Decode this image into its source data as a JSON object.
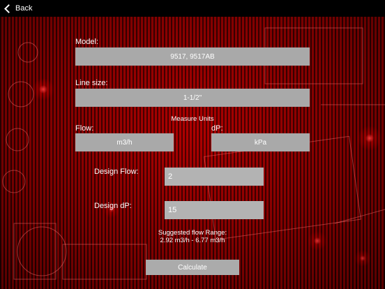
{
  "nav": {
    "back_label": "Back"
  },
  "form": {
    "model_label": "Model:",
    "model_value": "9517, 9517AB",
    "line_size_label": "Line size:",
    "line_size_value": "1-1/2\"",
    "measure_units_label": "Measure Units",
    "flow_label": "Flow:",
    "flow_unit": "m3/h",
    "dp_label": "dP:",
    "dp_unit": "kPa",
    "design_flow_label": "Design Flow:",
    "design_flow_value": "2",
    "design_dp_label": "Design dP:",
    "design_dp_value": "15",
    "suggested_title": "Suggested flow Range:",
    "suggested_range": "2.92 m3/h - 6.77 m3/h",
    "calculate_label": "Calculate"
  },
  "icons": [
    "chevron-left-icon"
  ],
  "colors": {
    "accent": "#b30000",
    "field": "#a9a9a9",
    "topbar": "#000000"
  }
}
